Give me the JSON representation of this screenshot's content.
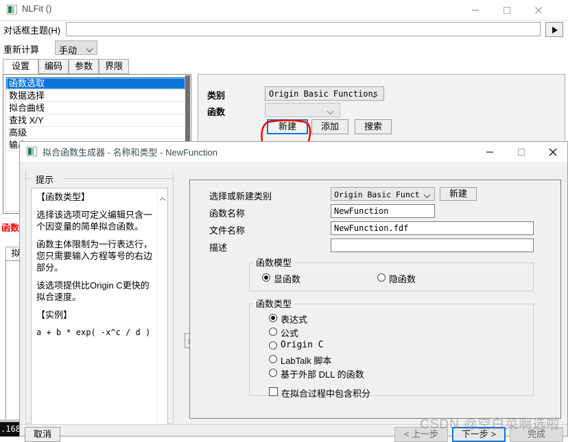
{
  "main_window": {
    "title": "NLFit ()",
    "icon": "origin-app-icon",
    "controls": {
      "minimize": "minimize-icon",
      "maximize": "maximize-icon",
      "close": "close-icon"
    },
    "theme_row": {
      "label": "对话框主题(H)",
      "value": "",
      "placeholder": "",
      "go_button": "play-icon"
    },
    "recalc_row": {
      "label": "重新计算",
      "value": "手动"
    },
    "tabs": [
      {
        "label": "设置",
        "active": true
      },
      {
        "label": "编码",
        "active": false
      },
      {
        "label": "参数",
        "active": false
      },
      {
        "label": "界限",
        "active": false
      }
    ],
    "nav_list": [
      {
        "label": "函数选取",
        "selected": true
      },
      {
        "label": "数据选择",
        "selected": false
      },
      {
        "label": "拟合曲线",
        "selected": false
      },
      {
        "label": "查找 X/Y",
        "selected": false
      },
      {
        "label": "高级",
        "selected": false
      },
      {
        "label": "输出",
        "selected": false
      }
    ],
    "red_label": "函数",
    "mini_tab": "拟",
    "status_strip": ".168",
    "settings_panel": {
      "category_label": "类别",
      "category_value": "Origin Basic Functions",
      "function_label": "函数",
      "function_value": "",
      "buttons": [
        {
          "label": "新建",
          "highlighted": true
        },
        {
          "label": "添加",
          "highlighted": false
        },
        {
          "label": "搜索",
          "highlighted": false
        }
      ]
    }
  },
  "dialog": {
    "title": "拟合函数生成器 - 名称和类型 - NewFunction",
    "icon": "origin-app-icon",
    "controls": {
      "minimize": "minimize-icon",
      "maximize": "maximize-icon",
      "close": "close-icon"
    },
    "tips": {
      "legend": "提示",
      "heading": "【函数类型】",
      "paragraphs": [
        "选择该选项可定义编辑只含一个因变量的简单拟合函数。",
        "函数主体限制为一行表达行，您只需要输入方程等号的右边部分。",
        "该选项提供比Origin C更快的拟合速度。"
      ],
      "example_heading": "【实例】",
      "example_code": "a + b * exp( -x^c / d )",
      "scroll_up_icon": "chevron-up-icon"
    },
    "expand_button": "double-chevron-right-icon",
    "form": {
      "fields": [
        {
          "label": "选择或新建类别",
          "value": "Origin Basic Function",
          "type": "select"
        },
        {
          "label": "函数名称",
          "value": "NewFunction",
          "type": "text"
        },
        {
          "label": "文件名称",
          "value": "NewFunction.fdf",
          "type": "text"
        },
        {
          "label": "描述",
          "value": "",
          "type": "text"
        }
      ],
      "new_category_button": "新建",
      "function_model": {
        "legend": "函数模型",
        "options": [
          {
            "label": "显函数",
            "selected": true
          },
          {
            "label": "隐函数",
            "selected": false
          }
        ]
      },
      "function_type": {
        "legend": "函数类型",
        "options": [
          {
            "label": "表达式",
            "selected": true
          },
          {
            "label": "公式",
            "selected": false
          },
          {
            "label": "Origin C",
            "selected": false
          },
          {
            "label": "LabTalk 脚本",
            "selected": false
          },
          {
            "label": "基于外部 DLL 的函数",
            "selected": false
          }
        ],
        "checkbox": {
          "label": "在拟合过程中包含积分",
          "checked": false
        }
      }
    },
    "footer": {
      "cancel": "取消",
      "prev": "< 上一步",
      "next": "下一步 >",
      "finish": "完成"
    }
  },
  "watermark": "CSDN @空白菜啊选啦",
  "colors": {
    "accent_blue": "#0a74d6",
    "selection_blue": "#0a74d6",
    "annotation_red": "#ff0000",
    "panel_gray": "#f0f0f0"
  }
}
